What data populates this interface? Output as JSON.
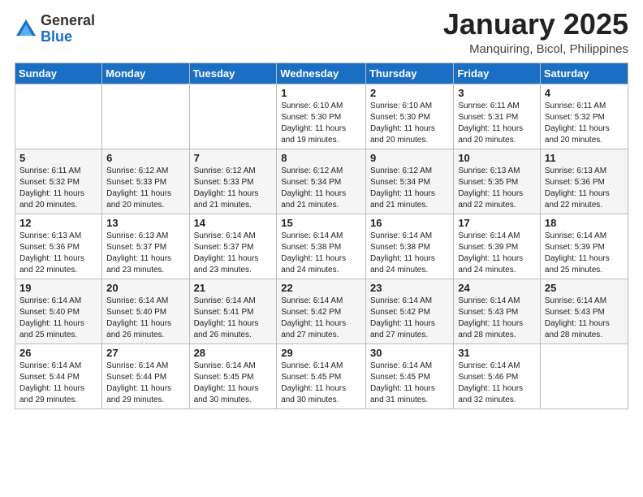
{
  "header": {
    "logo_general": "General",
    "logo_blue": "Blue",
    "month_title": "January 2025",
    "location": "Manquiring, Bicol, Philippines"
  },
  "days_of_week": [
    "Sunday",
    "Monday",
    "Tuesday",
    "Wednesday",
    "Thursday",
    "Friday",
    "Saturday"
  ],
  "weeks": [
    [
      {
        "day": "",
        "info": ""
      },
      {
        "day": "",
        "info": ""
      },
      {
        "day": "",
        "info": ""
      },
      {
        "day": "1",
        "info": "Sunrise: 6:10 AM\nSunset: 5:30 PM\nDaylight: 11 hours and 19 minutes."
      },
      {
        "day": "2",
        "info": "Sunrise: 6:10 AM\nSunset: 5:30 PM\nDaylight: 11 hours and 20 minutes."
      },
      {
        "day": "3",
        "info": "Sunrise: 6:11 AM\nSunset: 5:31 PM\nDaylight: 11 hours and 20 minutes."
      },
      {
        "day": "4",
        "info": "Sunrise: 6:11 AM\nSunset: 5:32 PM\nDaylight: 11 hours and 20 minutes."
      }
    ],
    [
      {
        "day": "5",
        "info": "Sunrise: 6:11 AM\nSunset: 5:32 PM\nDaylight: 11 hours and 20 minutes."
      },
      {
        "day": "6",
        "info": "Sunrise: 6:12 AM\nSunset: 5:33 PM\nDaylight: 11 hours and 20 minutes."
      },
      {
        "day": "7",
        "info": "Sunrise: 6:12 AM\nSunset: 5:33 PM\nDaylight: 11 hours and 21 minutes."
      },
      {
        "day": "8",
        "info": "Sunrise: 6:12 AM\nSunset: 5:34 PM\nDaylight: 11 hours and 21 minutes."
      },
      {
        "day": "9",
        "info": "Sunrise: 6:12 AM\nSunset: 5:34 PM\nDaylight: 11 hours and 21 minutes."
      },
      {
        "day": "10",
        "info": "Sunrise: 6:13 AM\nSunset: 5:35 PM\nDaylight: 11 hours and 22 minutes."
      },
      {
        "day": "11",
        "info": "Sunrise: 6:13 AM\nSunset: 5:36 PM\nDaylight: 11 hours and 22 minutes."
      }
    ],
    [
      {
        "day": "12",
        "info": "Sunrise: 6:13 AM\nSunset: 5:36 PM\nDaylight: 11 hours and 22 minutes."
      },
      {
        "day": "13",
        "info": "Sunrise: 6:13 AM\nSunset: 5:37 PM\nDaylight: 11 hours and 23 minutes."
      },
      {
        "day": "14",
        "info": "Sunrise: 6:14 AM\nSunset: 5:37 PM\nDaylight: 11 hours and 23 minutes."
      },
      {
        "day": "15",
        "info": "Sunrise: 6:14 AM\nSunset: 5:38 PM\nDaylight: 11 hours and 24 minutes."
      },
      {
        "day": "16",
        "info": "Sunrise: 6:14 AM\nSunset: 5:38 PM\nDaylight: 11 hours and 24 minutes."
      },
      {
        "day": "17",
        "info": "Sunrise: 6:14 AM\nSunset: 5:39 PM\nDaylight: 11 hours and 24 minutes."
      },
      {
        "day": "18",
        "info": "Sunrise: 6:14 AM\nSunset: 5:39 PM\nDaylight: 11 hours and 25 minutes."
      }
    ],
    [
      {
        "day": "19",
        "info": "Sunrise: 6:14 AM\nSunset: 5:40 PM\nDaylight: 11 hours and 25 minutes."
      },
      {
        "day": "20",
        "info": "Sunrise: 6:14 AM\nSunset: 5:40 PM\nDaylight: 11 hours and 26 minutes."
      },
      {
        "day": "21",
        "info": "Sunrise: 6:14 AM\nSunset: 5:41 PM\nDaylight: 11 hours and 26 minutes."
      },
      {
        "day": "22",
        "info": "Sunrise: 6:14 AM\nSunset: 5:42 PM\nDaylight: 11 hours and 27 minutes."
      },
      {
        "day": "23",
        "info": "Sunrise: 6:14 AM\nSunset: 5:42 PM\nDaylight: 11 hours and 27 minutes."
      },
      {
        "day": "24",
        "info": "Sunrise: 6:14 AM\nSunset: 5:43 PM\nDaylight: 11 hours and 28 minutes."
      },
      {
        "day": "25",
        "info": "Sunrise: 6:14 AM\nSunset: 5:43 PM\nDaylight: 11 hours and 28 minutes."
      }
    ],
    [
      {
        "day": "26",
        "info": "Sunrise: 6:14 AM\nSunset: 5:44 PM\nDaylight: 11 hours and 29 minutes."
      },
      {
        "day": "27",
        "info": "Sunrise: 6:14 AM\nSunset: 5:44 PM\nDaylight: 11 hours and 29 minutes."
      },
      {
        "day": "28",
        "info": "Sunrise: 6:14 AM\nSunset: 5:45 PM\nDaylight: 11 hours and 30 minutes."
      },
      {
        "day": "29",
        "info": "Sunrise: 6:14 AM\nSunset: 5:45 PM\nDaylight: 11 hours and 30 minutes."
      },
      {
        "day": "30",
        "info": "Sunrise: 6:14 AM\nSunset: 5:45 PM\nDaylight: 11 hours and 31 minutes."
      },
      {
        "day": "31",
        "info": "Sunrise: 6:14 AM\nSunset: 5:46 PM\nDaylight: 11 hours and 32 minutes."
      },
      {
        "day": "",
        "info": ""
      }
    ]
  ]
}
